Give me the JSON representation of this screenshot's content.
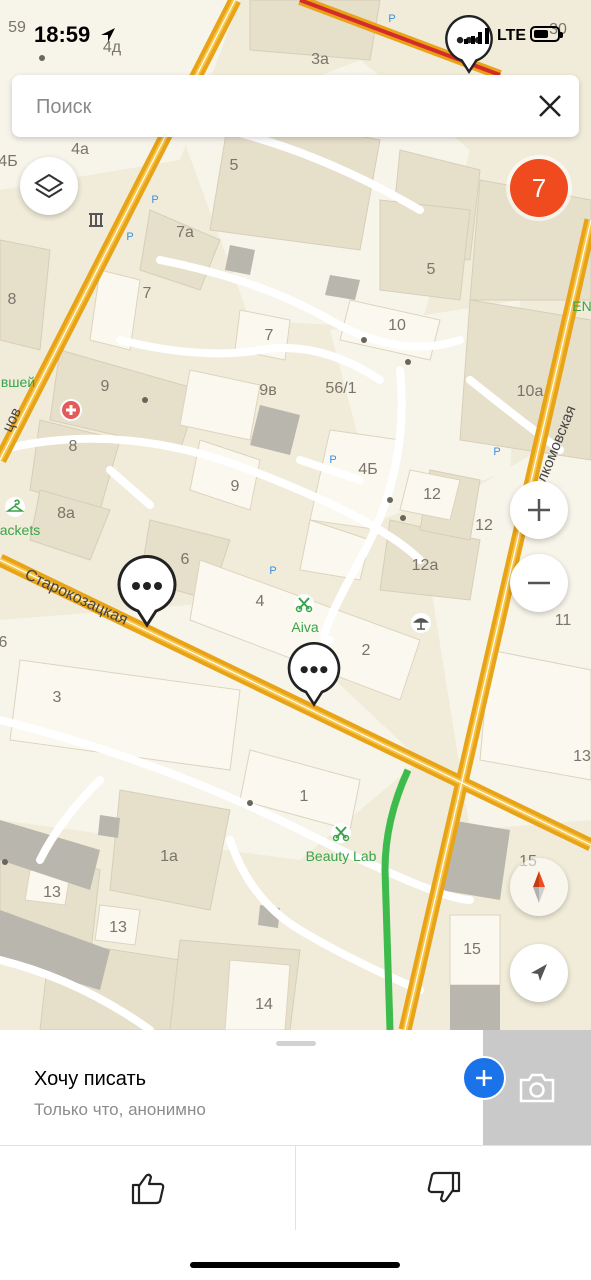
{
  "status_bar": {
    "time": "18:59",
    "network": "LTE"
  },
  "search": {
    "placeholder": "Поиск"
  },
  "map": {
    "cluster_count": "7",
    "house_numbers": [
      "59",
      "4д",
      "3а",
      "30",
      "4а",
      "4Б",
      "5",
      "7а",
      "5",
      "8",
      "7",
      "10",
      "7",
      "9",
      "9в",
      "56/1",
      "10а",
      "8",
      "9",
      "4Б",
      "12",
      "12",
      "8а",
      "6",
      "4",
      "12а",
      "11",
      "2",
      "3",
      "1",
      "1а",
      "13",
      "13",
      "15",
      "15",
      "14",
      "13",
      "6"
    ],
    "streets": [
      "Старокозацкая",
      "Исполкомовская",
      "цов"
    ],
    "poi": [
      "Aiva",
      "Beauty Lab",
      "ackets",
      "вшей",
      "EN"
    ]
  },
  "card": {
    "title": "Хочу писать",
    "subtitle": "Только что, анонимно"
  },
  "actions": {
    "like": "thumbs-up",
    "dislike": "thumbs-down"
  }
}
